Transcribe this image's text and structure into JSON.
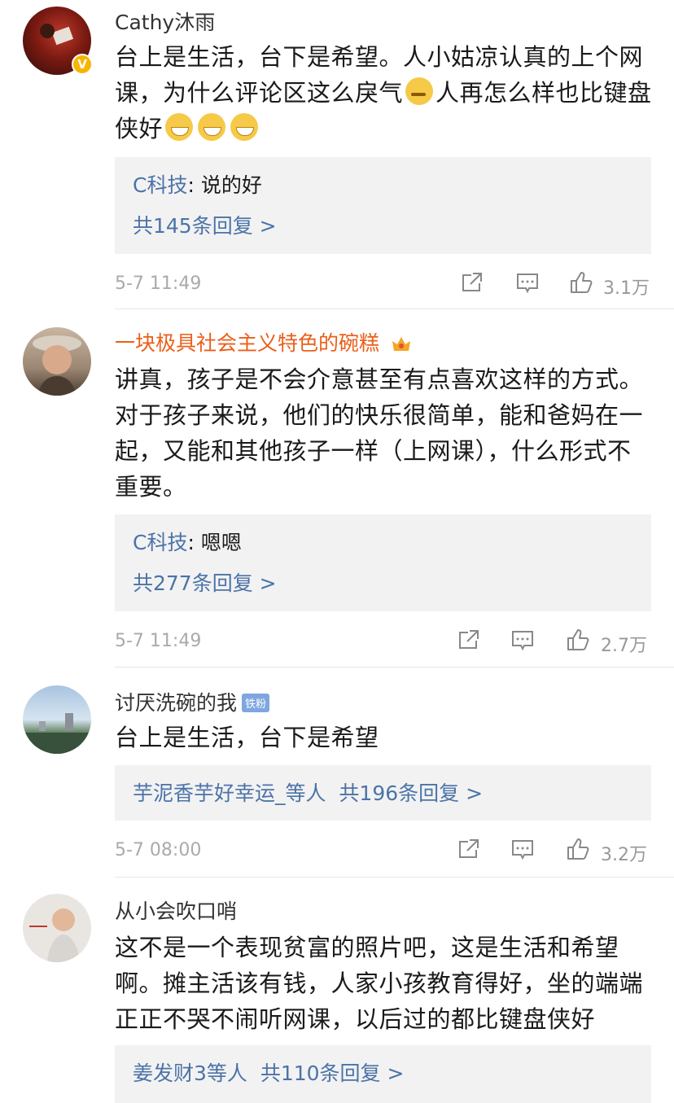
{
  "colors": {
    "reply_user": "#4b73a8",
    "vip_name": "#ea5f1a",
    "reply_bg": "#f2f2f2",
    "meta": "#aaaaaa"
  },
  "comments": [
    {
      "username": "Cathy沐雨",
      "verified_badge": "V",
      "text_part1": "台上是生活，台下是希望。人小姑凉认真的上个网课，为什么评论区这么戾气",
      "text_part2": "人再怎么样也比键盘侠好",
      "reply_user": "C科技",
      "reply_text": ": 说的好",
      "reply_count": "共145条回复 >",
      "time": "5-7 11:49",
      "likes": "3.1万",
      "emoji_icons": [
        "sleepy-emoji-icon",
        "grin-emoji-icon",
        "grin-emoji-icon",
        "grin-emoji-icon"
      ]
    },
    {
      "username": "一块极具社会主义特色的碗糕",
      "text": "讲真，孩子是不会介意甚至有点喜欢这样的方式。对于孩子来说，他们的快乐很简单，能和爸妈在一起，又能和其他孩子一样（上网课），什么形式不重要。",
      "reply_user": "C科技",
      "reply_text": ": 嗯嗯",
      "reply_count": "共277条回复 >",
      "time": "5-7 11:49",
      "likes": "2.7万"
    },
    {
      "username": "讨厌洗碗的我",
      "fan_badge": "铁粉",
      "text": "台上是生活，台下是希望",
      "reply_summary": "芋泥香芋好幸运_等人",
      "reply_count": "共196条回复 >",
      "time": "5-7 08:00",
      "likes": "3.2万"
    },
    {
      "username": "从小会吹口哨",
      "text": "这不是一个表现贫富的照片吧，这是生活和希望啊。摊主活该有钱，人家小孩教育得好，坐的端端正正不哭不闹听网课，以后过的都比键盘侠好",
      "reply_summary": "姜发财3等人",
      "reply_count": "共110条回复 >"
    }
  ]
}
